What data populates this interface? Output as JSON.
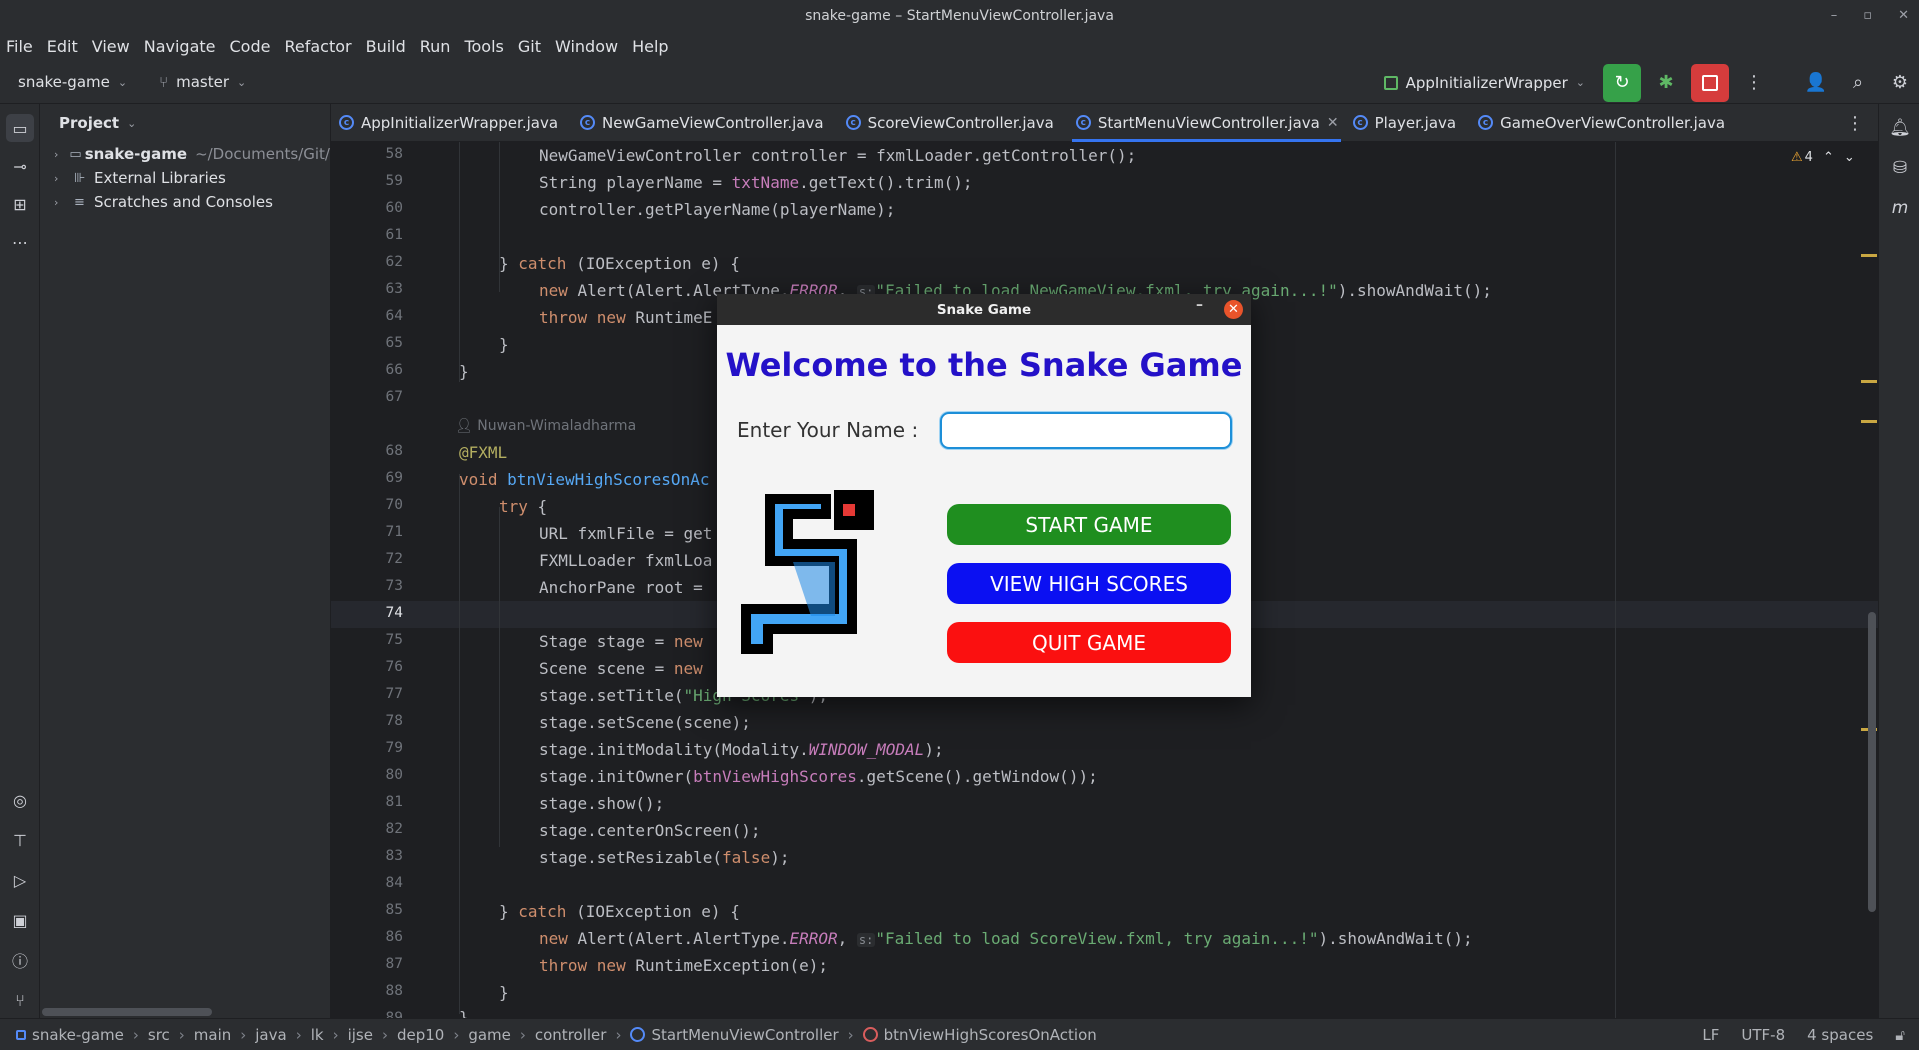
{
  "window": {
    "title": "snake-game – StartMenuViewController.java",
    "controls": [
      "–",
      "▫",
      "✕"
    ]
  },
  "menu": [
    "File",
    "Edit",
    "View",
    "Navigate",
    "Code",
    "Refactor",
    "Build",
    "Run",
    "Tools",
    "Git",
    "Window",
    "Help"
  ],
  "toolbar": {
    "project": "snake-game",
    "branch": "master",
    "run_config": "AppInitializerWrapper"
  },
  "project_panel": {
    "title": "Project",
    "items": [
      {
        "name": "snake-game",
        "path": "~/Documents/Git/"
      },
      {
        "name": "External Libraries"
      },
      {
        "name": "Scratches and Consoles"
      }
    ]
  },
  "tabs": [
    {
      "label": "AppInitializerWrapper.java"
    },
    {
      "label": "NewGameViewController.java"
    },
    {
      "label": "ScoreViewController.java"
    },
    {
      "label": "StartMenuViewController.java"
    },
    {
      "label": "Player.java"
    },
    {
      "label": "GameOverViewController.java"
    }
  ],
  "editor": {
    "warning_count": "4",
    "author_hint": "Nuwan-Wimaladharma",
    "line_numbers": [
      "58",
      "59",
      "60",
      "61",
      "62",
      "63",
      "64",
      "65",
      "66",
      "67",
      "68",
      "69",
      "70",
      "71",
      "72",
      "73",
      "74",
      "75",
      "76",
      "77",
      "78",
      "79",
      "80",
      "81",
      "82",
      "83",
      "84",
      "85",
      "86",
      "87",
      "88",
      "89"
    ],
    "strings": {
      "l58a": "NewGameViewController controller = fxmlLoader.getController();",
      "l59a": "String playerName = ",
      "l59b": "txtName",
      "l59c": ".getText().trim();",
      "l60a": "controller.getPlayerName(playerName);",
      "l62a": "} ",
      "l62b": "catch",
      "l62c": " (IOException e) {",
      "l63a": "new",
      "l63b": " Alert(Alert.AlertType.",
      "l63c": "ERROR",
      "l63d": "s:",
      "l63e": "\"Failed to load NewGameView.fxml, try again...!\"",
      "l63f": ").showAndWait();",
      "l64a": "throw new",
      "l64b": " RuntimeE",
      "l65a": "}",
      "l66a": "}",
      "l68a": "@FXML",
      "l69a": "void",
      "l69b": "btnViewHighScoresOnAc",
      "l70a": "try",
      "l70b": " {",
      "l71a": "URL fxmlFile = get",
      "l72a": "FXMLLoader fxmlLoa",
      "l73a": "AnchorPane root = ",
      "l75a": "Stage stage = ",
      "l75b": "new",
      "l76a": "Scene scene = ",
      "l76b": "new",
      "l77a": "stage.setTitle(",
      "l77b": "\"High Scores\"",
      "l77c": ");",
      "l78a": "stage.setScene(scene);",
      "l79a": "stage.initModality(Modality.",
      "l79b": "WINDOW_MODAL",
      "l79c": ");",
      "l80a": "stage.initOwner(",
      "l80b": "btnViewHighScores",
      "l80c": ".getScene().getWindow());",
      "l81a": "stage.show();",
      "l82a": "stage.centerOnScreen();",
      "l83a": "stage.setResizable(",
      "l83b": "false",
      "l83c": ");",
      "l85a": "} ",
      "l85b": "catch",
      "l85c": " (IOException e) {",
      "l86a": "new",
      "l86b": " Alert(Alert.AlertType.",
      "l86c": "ERROR",
      "l86d": ", ",
      "l86e": "s:",
      "l86f": "\"Failed to load ScoreView.fxml, try again...!\"",
      "l86g": ").showAndWait();",
      "l87a": "throw new",
      "l87b": " RuntimeException(e);",
      "l88a": "}",
      "l89a": "}"
    }
  },
  "dialog": {
    "title": "Snake Game",
    "heading": "Welcome to the Snake Game",
    "name_label": "Enter Your Name :",
    "name_value": "",
    "start_label": "START GAME",
    "scores_label": "VIEW HIGH SCORES",
    "quit_label": "QUIT GAME",
    "colors": {
      "heading": "#2411c8",
      "start": "#1f8e1f",
      "scores": "#0b10f2",
      "quit": "#fb1010"
    }
  },
  "statusbar": {
    "breadcrumb": [
      "snake-game",
      "src",
      "main",
      "java",
      "lk",
      "ijse",
      "dep10",
      "game",
      "controller",
      "StartMenuViewController",
      "btnViewHighScoresOnAction"
    ],
    "line_sep": "LF",
    "encoding": "UTF-8",
    "indent": "4 spaces"
  }
}
